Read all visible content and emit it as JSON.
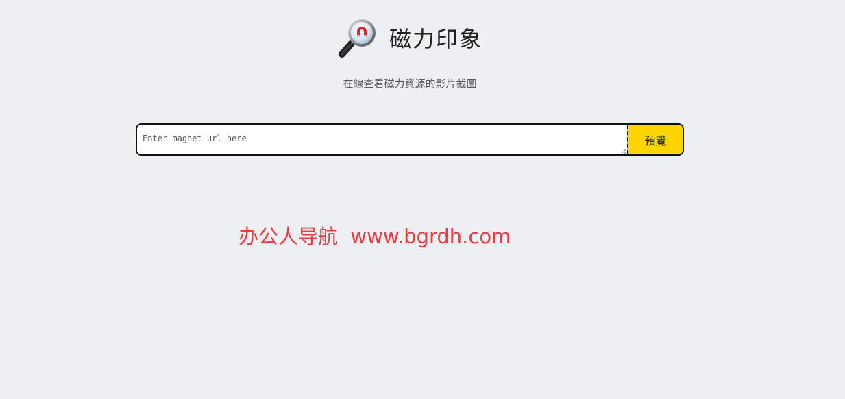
{
  "header": {
    "logo_icon": "magnifying-glass-magnet-icon",
    "title": "磁力印象",
    "subtitle": "在線查看磁力資源的影片截圖"
  },
  "search": {
    "placeholder": "Enter magnet url here",
    "value": "",
    "button_label": "預覽",
    "button_color": "#ffd500"
  },
  "watermark": {
    "text": "办公人导航  www.bgrdh.com",
    "color": "#ee3a3f"
  }
}
